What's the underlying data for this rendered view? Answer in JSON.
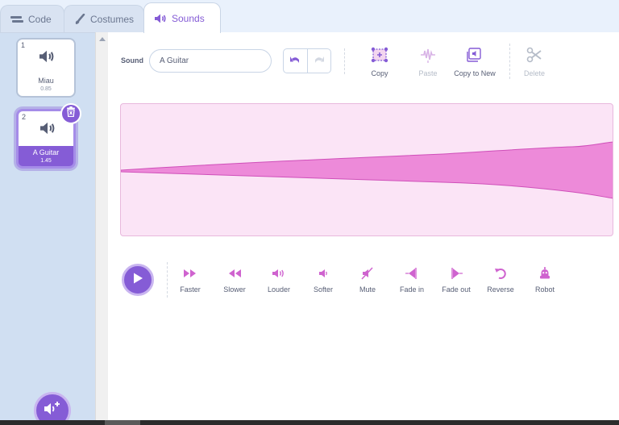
{
  "tabs": [
    {
      "label": "Code",
      "icon": "code-icon"
    },
    {
      "label": "Costumes",
      "icon": "brush-icon"
    },
    {
      "label": "Sounds",
      "icon": "speaker-icon",
      "active": true
    }
  ],
  "sounds_list": [
    {
      "number": "1",
      "name": "Miau",
      "duration": "0.85",
      "selected": false
    },
    {
      "number": "2",
      "name": "A Guitar",
      "duration": "1.45",
      "selected": true
    }
  ],
  "editor": {
    "sound_label": "Sound",
    "sound_name": "A Guitar",
    "toolbar": [
      {
        "label": "Copy",
        "icon": "copy-icon",
        "enabled": true
      },
      {
        "label": "Paste",
        "icon": "paste-icon",
        "enabled": false
      },
      {
        "label": "Copy to New",
        "icon": "copy-to-new-icon",
        "enabled": true
      },
      {
        "label": "Delete",
        "icon": "scissors-icon",
        "enabled": false
      }
    ],
    "effects": [
      {
        "label": "Faster",
        "icon": "faster-icon"
      },
      {
        "label": "Slower",
        "icon": "slower-icon"
      },
      {
        "label": "Louder",
        "icon": "louder-icon"
      },
      {
        "label": "Softer",
        "icon": "softer-icon"
      },
      {
        "label": "Mute",
        "icon": "mute-icon"
      },
      {
        "label": "Fade in",
        "icon": "fade-in-icon"
      },
      {
        "label": "Fade out",
        "icon": "fade-out-icon"
      },
      {
        "label": "Reverse",
        "icon": "reverse-icon"
      },
      {
        "label": "Robot",
        "icon": "robot-icon"
      }
    ]
  },
  "colors": {
    "accent": "#855cd6",
    "effect_pink": "#cf63cf",
    "waveform_fill": "#ed8ad9",
    "waveform_bg": "#fbe4f6"
  }
}
